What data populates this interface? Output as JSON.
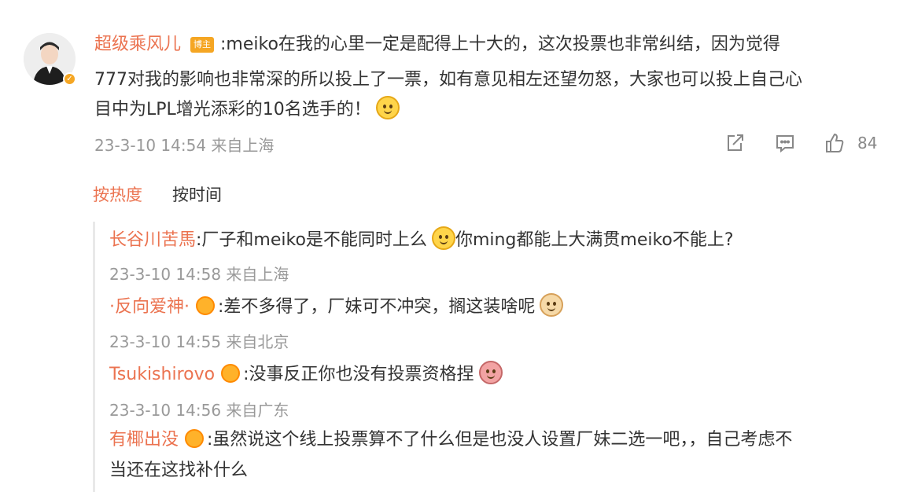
{
  "root": {
    "username": "超级乘风儿",
    "badge": "博主",
    "text_line1": ":meiko在我的心里一定是配得上十大的，这次投票也非常纠结，因为觉得",
    "text_line2": "777对我的影响也非常深的所以投上了一票，如有意见相左还望勿怒，大家也可以投上自己心",
    "text_line3": "目中为LPL增光添彩的10名选手的！",
    "timestamp": "23-3-10 14:54 来自上海",
    "likes": "84",
    "icons": [
      "share-icon",
      "comment-icon",
      "like-icon"
    ]
  },
  "tabs": [
    {
      "label": "按热度",
      "active": true
    },
    {
      "label": "按时间",
      "active": false
    }
  ],
  "replies": [
    {
      "name": "长谷川苦馬",
      "text_a": ":厂子和meiko是不能同时上么",
      "text_b": "你ming都能上大满贯meiko不能上?",
      "timestamp": "23-3-10 14:58 来自上海"
    },
    {
      "name": "·反向爱神·",
      "text_a": ":差不多得了，厂妹可不冲突，搁这装啥呢",
      "timestamp": "23-3-10 14:55 来自北京"
    },
    {
      "name": "Tsukishirovo",
      "text_a": ":没事反正你也没有投票资格捏",
      "timestamp": "23-3-10 14:56 来自广东"
    },
    {
      "name": "有椰出没",
      "text_a": ":虽然说这个线上投票算不了什么但是也没人设置厂妹二选一吧，，自己考虑不",
      "text_b": "当还在这找补什么"
    }
  ],
  "colors": {
    "accent": "#eb7350",
    "meta": "#999999",
    "text": "#333333"
  }
}
